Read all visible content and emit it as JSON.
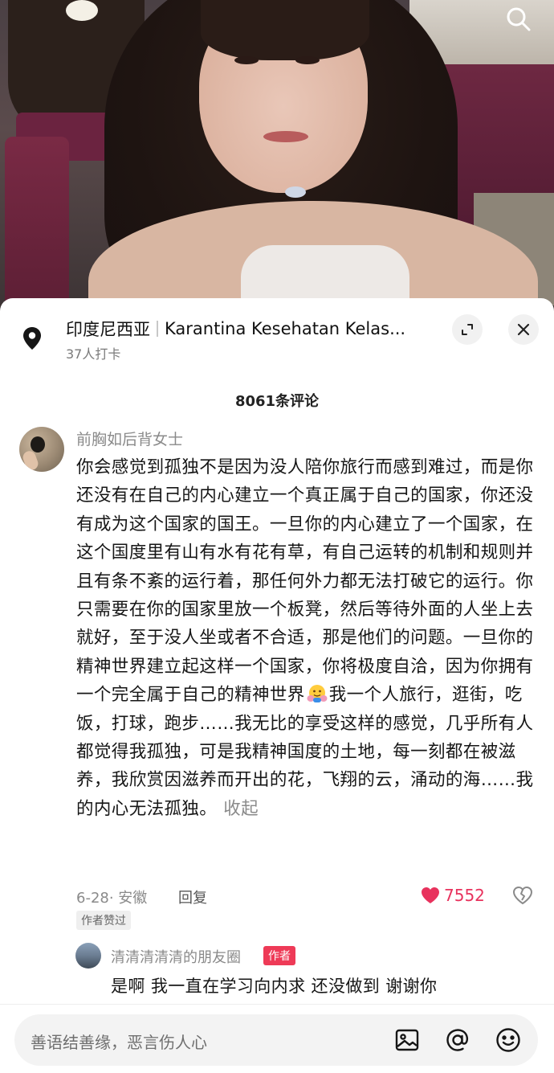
{
  "location": {
    "name": "印度尼西亚",
    "place": "Karantina Kesehatan Kelas...",
    "checkins": "37人打卡"
  },
  "comments_header": "8061条评论",
  "comment": {
    "username": "前胸如后背女士",
    "text_part1": "你会感觉到孤独不是因为没人陪你旅行而感到难过，而是你还没有在自己的内心建立一个真正属于自己的国家，你还没有成为这个国家的国王。一旦你的内心建立了一个国家，在这个国度里有山有水有花有草，有自己运转的机制和规则并且有条不紊的运行着，那任何外力都无法打破它的运行。你只需要在你的国家里放一个板凳，然后等待外面的人坐上去就好，至于没人坐或者不合适，那是他们的问题。一旦你的精神世界建立起这样一个国家，你将极度自洽，因为你拥有一个完全属于自己的精神世界",
    "text_part2": "我一个人旅行，逛街，吃饭，打球，跑步……我无比的享受这样的感觉，几乎所有人都觉得我孤独，可是我精神国度的土地，每一刻都在被滋养，我欣赏因滋养而开出的花，飞翔的云，涌动的海……我的内心无法孤独。",
    "collapse_label": "收起",
    "meta": "6-28· 安徽",
    "reply_label": "回复",
    "likes": "7552",
    "author_liked_badge": "作者赞过",
    "emoji_icon": "hugging-face-emoji"
  },
  "reply": {
    "username": "清清清清清的朋友圈",
    "author_badge": "作者",
    "text": "是啊 我一直在学习向内求 还没做到 谢谢你"
  },
  "input": {
    "placeholder": "善语结善缘，恶言伤人心"
  },
  "icons": {
    "search": "search-icon",
    "location": "location-pin-icon",
    "expand": "expand-icon",
    "close": "close-icon",
    "like": "heart-icon",
    "dislike": "broken-heart-icon",
    "image": "image-icon",
    "mention": "at-icon",
    "emoji": "emoji-icon"
  },
  "colors": {
    "like": "#e8325d",
    "author_badge": "#ee3a57",
    "muted_text": "#8a8a8a"
  }
}
